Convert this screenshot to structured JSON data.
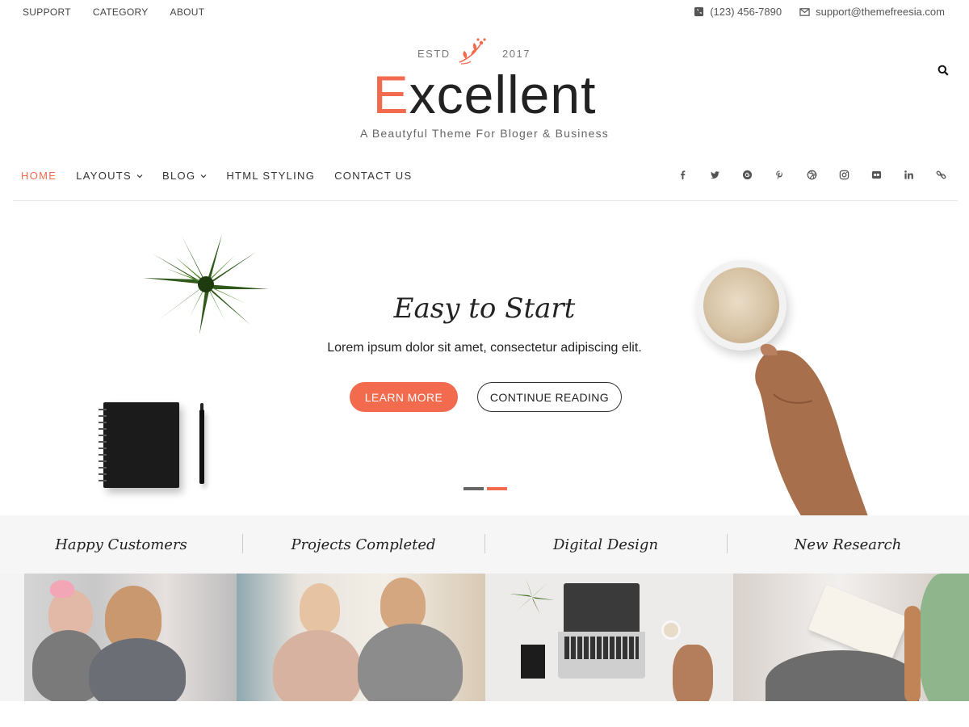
{
  "topbar": {
    "links": [
      "SUPPORT",
      "CATEGORY",
      "ABOUT"
    ],
    "phone": "(123) 456-7890",
    "email": "support@themefreesia.com"
  },
  "branding": {
    "estd_label": "ESTD",
    "estd_year": "2017",
    "logo_first": "E",
    "logo_rest": "xcellent",
    "tagline": "A Beautyful Theme For Bloger & Business"
  },
  "nav": {
    "items": [
      {
        "label": "HOME",
        "active": true,
        "dropdown": false
      },
      {
        "label": "LAYOUTS",
        "active": false,
        "dropdown": true
      },
      {
        "label": "BLOG",
        "active": false,
        "dropdown": true
      },
      {
        "label": "HTML STYLING",
        "active": false,
        "dropdown": false
      },
      {
        "label": "CONTACT US",
        "active": false,
        "dropdown": false
      }
    ],
    "social_icons": [
      "facebook-icon",
      "twitter-icon",
      "google-plus-icon",
      "pinterest-icon",
      "dribbble-icon",
      "instagram-icon",
      "flickr-icon",
      "linkedin-icon",
      "link-icon"
    ]
  },
  "hero": {
    "title": "Easy to Start",
    "subtitle": "Lorem ipsum dolor sit amet, consectetur adipiscing elit.",
    "primary_button": "LEARN MORE",
    "secondary_button": "CONTINUE READING",
    "slides": 2,
    "active_slide": 2
  },
  "features": [
    "Happy Customers",
    "Projects Completed",
    "Digital Design",
    "New Research"
  ],
  "colors": {
    "accent": "#f26b4f",
    "text": "#222222",
    "feature_bg": "#f6f6f6"
  }
}
